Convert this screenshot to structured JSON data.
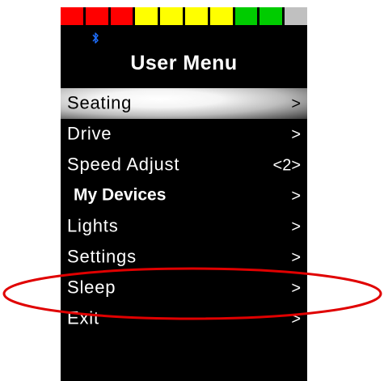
{
  "battery": {
    "segments": [
      {
        "color": "#ff0000"
      },
      {
        "color": "#ff0000"
      },
      {
        "color": "#ff0000"
      },
      {
        "color": "#ffff00"
      },
      {
        "color": "#ffff00"
      },
      {
        "color": "#ffff00"
      },
      {
        "color": "#ffff00"
      },
      {
        "color": "#00cc00"
      },
      {
        "color": "#00cc00"
      },
      {
        "color": "#c0c0c0"
      }
    ],
    "filled_segments": 9,
    "total_segments": 10
  },
  "status": {
    "bluetooth_icon": "bluetooth-icon",
    "bluetooth_color": "#1e6fff"
  },
  "menu": {
    "title": "User Menu",
    "items": [
      {
        "label": "Seating",
        "value": ">",
        "selected": true,
        "bold": false
      },
      {
        "label": "Drive",
        "value": ">",
        "selected": false,
        "bold": false
      },
      {
        "label": "Speed Adjust",
        "value": "<2>",
        "selected": false,
        "bold": false
      },
      {
        "label": "My Devices",
        "value": ">",
        "selected": false,
        "bold": true
      },
      {
        "label": "Lights",
        "value": ">",
        "selected": false,
        "bold": false
      },
      {
        "label": "Settings",
        "value": ">",
        "selected": false,
        "bold": false
      },
      {
        "label": "Sleep",
        "value": ">",
        "selected": false,
        "bold": false,
        "circled": true
      },
      {
        "label": "Exit",
        "value": ">",
        "selected": false,
        "bold": false
      }
    ]
  },
  "annotation": {
    "circle_color": "#e00000",
    "circled_item": "Sleep"
  }
}
